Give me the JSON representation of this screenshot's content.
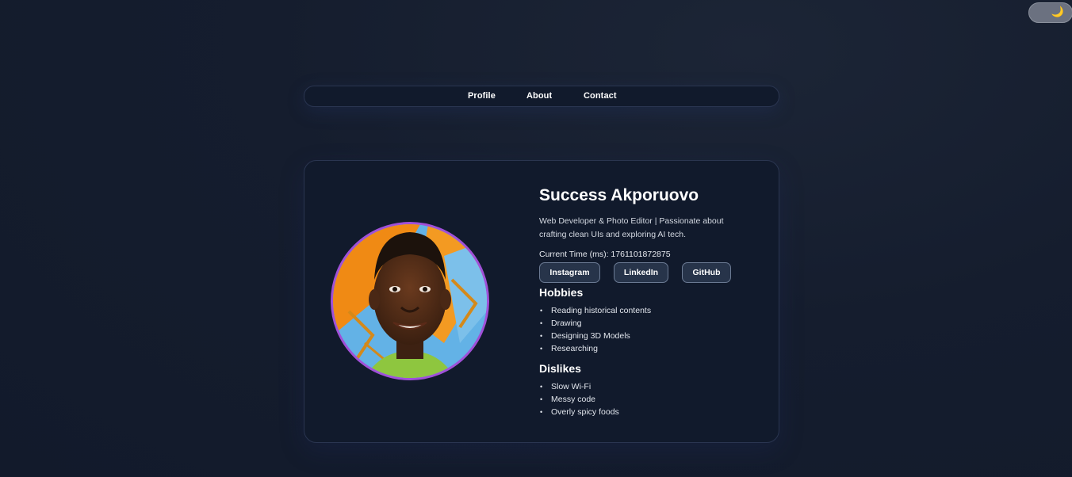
{
  "theme_toggle": {
    "icon": "moon-icon",
    "glyph": "🌙"
  },
  "nav": {
    "links": [
      "Profile",
      "About",
      "Contact"
    ]
  },
  "profile": {
    "name": "Success Akporuovo",
    "bio": "Web Developer & Photo Editor | Passionate about crafting clean UIs and exploring AI tech.",
    "time_label": "Current Time (ms): 1761101872875",
    "social": [
      "Instagram",
      "LinkedIn",
      "GitHub"
    ],
    "hobbies_title": "Hobbies",
    "hobbies": [
      "Reading historical contents",
      "Drawing",
      "Designing 3D Models",
      "Researching"
    ],
    "dislikes_title": "Dislikes",
    "dislikes": [
      "Slow Wi-Fi",
      "Messy code",
      "Overly spicy foods"
    ]
  },
  "colors": {
    "background": "#141c2d",
    "card": "#111a2c",
    "avatar_ring": "#a050d8",
    "button": "#27344a"
  }
}
